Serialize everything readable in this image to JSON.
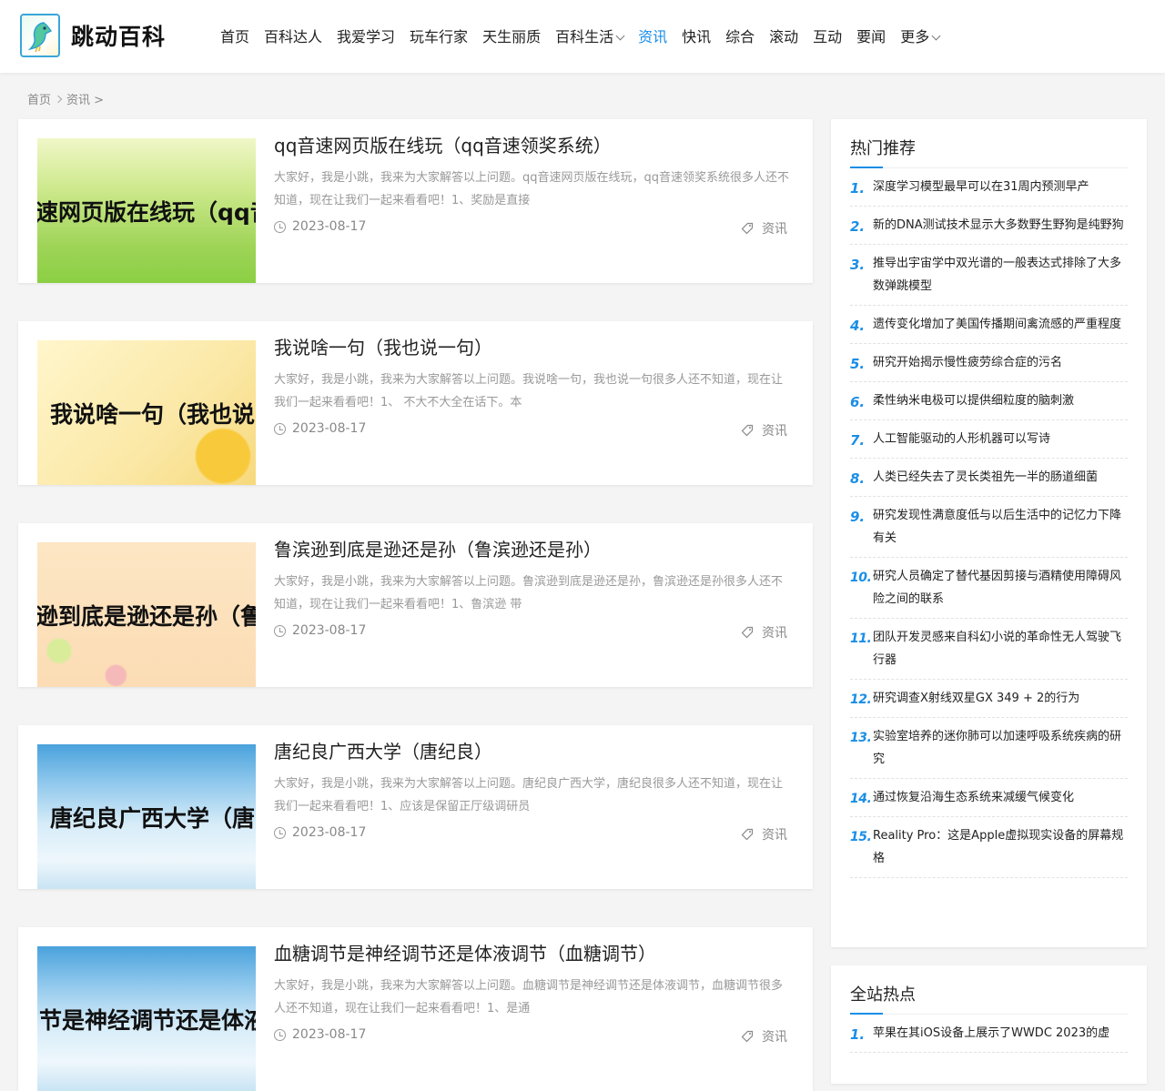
{
  "site": {
    "name": "跳动百科"
  },
  "nav": {
    "items": [
      {
        "label": "首页",
        "active": false,
        "dropdown": false
      },
      {
        "label": "百科达人",
        "active": false,
        "dropdown": false
      },
      {
        "label": "我爱学习",
        "active": false,
        "dropdown": false
      },
      {
        "label": "玩车行家",
        "active": false,
        "dropdown": false
      },
      {
        "label": "天生丽质",
        "active": false,
        "dropdown": false
      },
      {
        "label": "百科生活",
        "active": false,
        "dropdown": true
      },
      {
        "label": "资讯",
        "active": true,
        "dropdown": false
      },
      {
        "label": "快讯",
        "active": false,
        "dropdown": false
      },
      {
        "label": "综合",
        "active": false,
        "dropdown": false
      },
      {
        "label": "滚动",
        "active": false,
        "dropdown": false
      },
      {
        "label": "互动",
        "active": false,
        "dropdown": false
      },
      {
        "label": "要闻",
        "active": false,
        "dropdown": false
      },
      {
        "label": "更多",
        "active": false,
        "dropdown": true
      }
    ]
  },
  "breadcrumb": {
    "home": "首页",
    "current": "资讯 >"
  },
  "articles": [
    {
      "title": "qq音速网页版在线玩（qq音速领奖系统）",
      "thumb_text": "速网页版在线玩（qq音",
      "desc": "大家好，我是小跳，我来为大家解答以上问题。qq音速网页版在线玩，qq音速领奖系统很多人还不知道，现在让我们一起来看看吧！1、奖励是直接",
      "date": "2023-08-17",
      "tag": "资讯"
    },
    {
      "title": "我说啥一句（我也说一句）",
      "thumb_text": "我说啥一句（我也说",
      "desc": "大家好，我是小跳，我来为大家解答以上问题。我说啥一句，我也说一句很多人还不知道，现在让我们一起来看看吧！1、 不大不大全在话下。本",
      "date": "2023-08-17",
      "tag": "资讯"
    },
    {
      "title": "鲁滨逊到底是逊还是孙（鲁滨逊还是孙）",
      "thumb_text": "逊到底是逊还是孙（鲁",
      "desc": "大家好，我是小跳，我来为大家解答以上问题。鲁滨逊到底是逊还是孙，鲁滨逊还是孙很多人还不知道，现在让我们一起来看看吧！1、鲁滨逊 带",
      "date": "2023-08-17",
      "tag": "资讯"
    },
    {
      "title": "唐纪良广西大学（唐纪良）",
      "thumb_text": "唐纪良广西大学（唐",
      "desc": "大家好，我是小跳，我来为大家解答以上问题。唐纪良广西大学，唐纪良很多人还不知道，现在让我们一起来看看吧！1、应该是保留正厅级调研员",
      "date": "2023-08-17",
      "tag": "资讯"
    },
    {
      "title": "血糖调节是神经调节还是体液调节（血糖调节）",
      "thumb_text": "节是神经调节还是体液",
      "desc": "大家好，我是小跳，我来为大家解答以上问题。血糖调节是神经调节还是体液调节，血糖调节很多人还不知道，现在让我们一起来看看吧！1、是通",
      "date": "2023-08-17",
      "tag": "资讯"
    }
  ],
  "hot": {
    "title": "热门推荐",
    "items": [
      {
        "num": "1.",
        "text": "深度学习模型最早可以在31周内预测早产"
      },
      {
        "num": "2.",
        "text": "新的DNA测试技术显示大多数野生野狗是纯野狗"
      },
      {
        "num": "3.",
        "text": "推导出宇宙学中双光谱的一般表达式排除了大多数弹跳模型"
      },
      {
        "num": "4.",
        "text": "遗传变化增加了美国传播期间禽流感的严重程度"
      },
      {
        "num": "5.",
        "text": "研究开始揭示慢性疲劳综合症的污名"
      },
      {
        "num": "6.",
        "text": "柔性纳米电极可以提供细粒度的脑刺激"
      },
      {
        "num": "7.",
        "text": "人工智能驱动的人形机器可以写诗"
      },
      {
        "num": "8.",
        "text": "人类已经失去了灵长类祖先一半的肠道细菌"
      },
      {
        "num": "9.",
        "text": "研究发现性满意度低与以后生活中的记忆力下降有关"
      },
      {
        "num": "10.",
        "text": "研究人员确定了替代基因剪接与酒精使用障碍风险之间的联系"
      },
      {
        "num": "11.",
        "text": "团队开发灵感来自科幻小说的革命性无人驾驶飞行器"
      },
      {
        "num": "12.",
        "text": "研究调查X射线双星GX 349 + 2的行为"
      },
      {
        "num": "13.",
        "text": "实验室培养的迷你肺可以加速呼吸系统疾病的研究"
      },
      {
        "num": "14.",
        "text": "通过恢复沿海生态系统来减缓气候变化"
      },
      {
        "num": "15.",
        "text": "Reality Pro：这是Apple虚拟现实设备的屏幕规格"
      }
    ]
  },
  "site_hot": {
    "title": "全站热点",
    "items": [
      {
        "num": "1.",
        "text": "苹果在其iOS设备上展示了WWDC 2023的虚"
      }
    ]
  },
  "colors": {
    "accent": "#1a8ee6",
    "card_bg": "#ffffff",
    "page_bg": "#f4f4f4"
  },
  "icons": {
    "logo": "parrot-logo-icon",
    "date": "clock-icon",
    "tag": "tag-icon",
    "dropdown": "chevron-down-icon",
    "breadcrumb_sep": "chevron-right-icon"
  }
}
